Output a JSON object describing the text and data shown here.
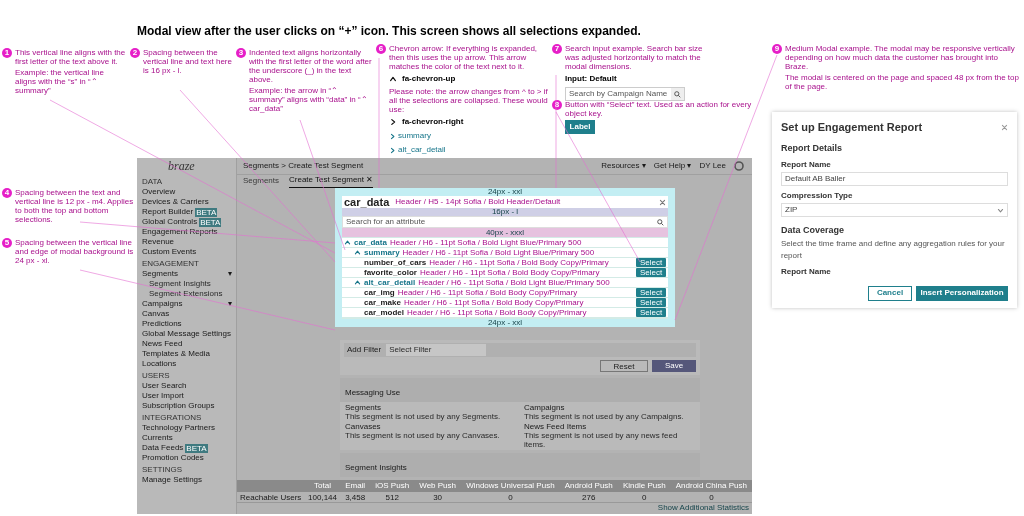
{
  "heading": "Modal view after the user clicks on “+” icon. This screen shows all selections expanded.",
  "annotations": [
    {
      "number": "1",
      "parts": [
        {
          "kind": "note",
          "text": "This vertical line aligns with the first letter of the text above it."
        },
        {
          "kind": "note",
          "text": "Example: the vertical line aligns with the “s” in “⌃ summary”"
        }
      ]
    },
    {
      "number": "2",
      "parts": [
        {
          "kind": "note",
          "text": "Spacing between the vertical line and text here is 16 px - l."
        }
      ]
    },
    {
      "number": "3",
      "parts": [
        {
          "kind": "note",
          "text": "Indented text aligns horizontally with the first letter of the word after the underscore (_) in the text above."
        },
        {
          "kind": "note",
          "text": "Example: the arrow in “⌃ summary” aligns with “data” in “⌃ car_data”"
        }
      ]
    },
    {
      "number": "4",
      "parts": [
        {
          "kind": "note",
          "text": "Spacing between the text and vertical line is 12 px - m4. Applies to both the top and bottom selections."
        }
      ]
    },
    {
      "number": "5",
      "parts": [
        {
          "kind": "note",
          "text": "Spacing between the vertical line and edge of modal background is 24 px - xl."
        }
      ]
    },
    {
      "number": "6",
      "parts": [
        {
          "kind": "note",
          "text": "Chevron arrow: If everything is expanded, then this uses the up arrow. This arrow matches the color of the text next to it."
        },
        {
          "kind": "icon-up",
          "text": "fa-chevron-up"
        },
        {
          "kind": "note",
          "text": "Please note: the arrow changes from ^ to > if all the selections are collapsed. These would use:"
        },
        {
          "kind": "icon-right",
          "text": "fa-chevron-right"
        },
        {
          "kind": "link",
          "text": "summary"
        },
        {
          "kind": "link",
          "text": "alt_car_detail"
        }
      ]
    },
    {
      "number": "7",
      "parts": [
        {
          "kind": "note",
          "text": "Search input example. Search bar size was adjusted horizontally to match the modal dimensions."
        },
        {
          "kind": "caption",
          "text": "Input: Default"
        },
        {
          "kind": "search",
          "text": "Search by Campaign Name"
        }
      ]
    },
    {
      "number": "8",
      "parts": [
        {
          "kind": "note",
          "text": "Button with “Select” text. Used as an action for every object key."
        },
        {
          "kind": "button",
          "text": "Label"
        }
      ]
    },
    {
      "number": "9",
      "parts": [
        {
          "kind": "note",
          "text": "Medium Modal example. The modal may be responsive vertically depending on how much data the customer has brought into Braze."
        },
        {
          "kind": "note",
          "text": "The modal is centered on the page and spaced 48 px from the top of the page."
        }
      ]
    }
  ],
  "app": {
    "logo": "braze",
    "breadcrumb": "Segments > Create Test Segment",
    "tabs": [
      {
        "label": "Segments",
        "selected": false
      },
      {
        "label": "Create Test Segment ✕",
        "selected": true
      }
    ],
    "top_links": [
      "Resources ▾",
      "Get Help ▾"
    ],
    "user": "DY Lee",
    "sidebar": [
      {
        "heading": "DATA",
        "items": [
          {
            "label": "Overview"
          },
          {
            "label": "Devices & Carriers"
          },
          {
            "label": "Report Builder",
            "badge": "BETA"
          },
          {
            "label": "Global Controls",
            "badge": "BETA"
          },
          {
            "label": "Engagement Reports"
          },
          {
            "label": "Revenue"
          },
          {
            "label": "Custom Events"
          }
        ]
      },
      {
        "heading": "ENGAGEMENT",
        "items": [
          {
            "label": "Segments",
            "caret": "▾",
            "children": [
              {
                "label": "Segment Insights"
              },
              {
                "label": "Segment Extensions"
              }
            ]
          },
          {
            "label": "Campaigns",
            "caret": "▾"
          },
          {
            "label": "Canvas"
          },
          {
            "label": "Predictions"
          },
          {
            "label": "Global Message Settings"
          },
          {
            "label": "News Feed"
          },
          {
            "label": "Templates & Media"
          },
          {
            "label": "Locations"
          }
        ]
      },
      {
        "heading": "USERS",
        "items": [
          {
            "label": "User Search"
          },
          {
            "label": "User Import"
          },
          {
            "label": "Subscription Groups"
          }
        ]
      },
      {
        "heading": "INTEGRATIONS",
        "items": [
          {
            "label": "Technology Partners"
          },
          {
            "label": "Currents"
          },
          {
            "label": "Data Feeds",
            "badge": "BETA"
          },
          {
            "label": "Promotion Codes"
          }
        ]
      },
      {
        "heading": "SETTINGS",
        "items": [
          {
            "label": "Manage Settings"
          }
        ]
      }
    ],
    "filter": {
      "label": "Add Filter",
      "placeholder": "Select Filter"
    },
    "actions": [
      "Reset",
      "Save"
    ],
    "messaging": {
      "title": "Messaging Use",
      "cells": [
        {
          "title": "Segments",
          "text": "This segment is not used by any Segments."
        },
        {
          "title": "Campaigns",
          "text": "This segment is not used by any Campaigns."
        },
        {
          "title": "Canvases",
          "text": "This segment is not used by any Canvases."
        },
        {
          "title": "News Feed Items",
          "text": "This segment is not used by any news feed items."
        }
      ]
    },
    "insights_title": "Segment Insights",
    "table": {
      "columns": [
        "Total",
        "Email",
        "iOS Push",
        "Web Push",
        "Windows Universal Push",
        "Android Push",
        "Kindle Push",
        "Android China Push"
      ],
      "rows": [
        {
          "label": "Reachable Users",
          "cells": [
            "100,144",
            "3,458",
            "512",
            "30",
            "0",
            "276",
            "0",
            "0"
          ]
        }
      ]
    },
    "footer_link": "Show Additional Statistics"
  },
  "modal": {
    "title": "car_data",
    "title_spec": "Header / H5 - 14pt Sofia / Bold Header/Default",
    "search_placeholder": "Search for an attribute",
    "tree": [
      {
        "label": "car_data",
        "spec": "Header / H6 - 11pt Sofia / Bold Light Blue/Primary 500",
        "expanded": true,
        "children": [
          {
            "label": "summary",
            "spec": "Header / H6 - 11pt Sofia / Bold Light Blue/Primary 500",
            "expanded": true,
            "children": [
              {
                "label": "number_of_cars",
                "spec": "Header / H6 - 11pt Sofia / Bold Body Copy/Primary",
                "action": "Select"
              },
              {
                "label": "favorite_color",
                "spec": "Header / H6 - 11pt Sofia / Bold Body Copy/Primary",
                "action": "Select"
              }
            ]
          },
          {
            "label": "alt_car_detail",
            "spec": "Header / H6 - 11pt Sofia / Bold Light Blue/Primary 500",
            "expanded": true,
            "children": [
              {
                "label": "car_img",
                "spec": "Header / H6 - 11pt Sofia / Bold Body Copy/Primary",
                "action": "Select"
              },
              {
                "label": "car_make",
                "spec": "Header / H6 - 11pt Sofia / Bold Body Copy/Primary",
                "action": "Select"
              },
              {
                "label": "car_model",
                "spec": "Header / H6 - 11pt Sofia / Bold Body Copy/Primary",
                "action": "Select"
              }
            ]
          }
        ]
      }
    ],
    "spacing": [
      "24px - xxl",
      "16px - l",
      "40px - xxxl",
      "24px - xxl"
    ]
  },
  "report_modal": {
    "title": "Set up Engagement Report",
    "section": "Report Details",
    "fields": [
      {
        "kind": "text",
        "label": "Report Name",
        "value": "Default AB Baller"
      },
      {
        "kind": "select",
        "label": "Compression Type",
        "value": "ZIP"
      }
    ],
    "section2": "Data Coverage",
    "section2_text": "Select the time frame and define any aggregation rules for your report",
    "field3_label": "Report Name",
    "buttons": [
      "Cancel",
      "Insert Personalization"
    ]
  }
}
